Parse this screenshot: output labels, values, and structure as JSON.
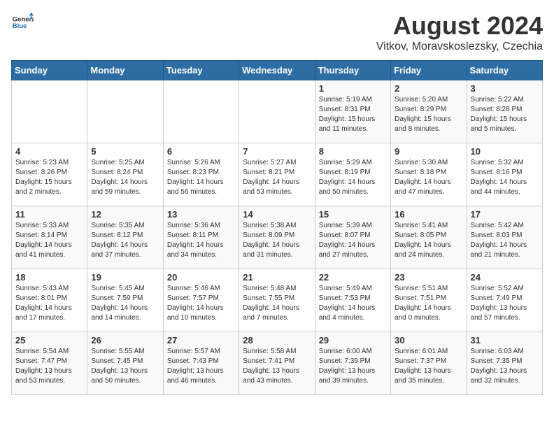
{
  "header": {
    "logo_general": "General",
    "logo_blue": "Blue",
    "title": "August 2024",
    "location": "Vitkov, Moravskoslezsky, Czechia"
  },
  "weekdays": [
    "Sunday",
    "Monday",
    "Tuesday",
    "Wednesday",
    "Thursday",
    "Friday",
    "Saturday"
  ],
  "weeks": [
    [
      {
        "day": "",
        "info": ""
      },
      {
        "day": "",
        "info": ""
      },
      {
        "day": "",
        "info": ""
      },
      {
        "day": "",
        "info": ""
      },
      {
        "day": "1",
        "info": "Sunrise: 5:19 AM\nSunset: 8:31 PM\nDaylight: 15 hours\nand 11 minutes."
      },
      {
        "day": "2",
        "info": "Sunrise: 5:20 AM\nSunset: 8:29 PM\nDaylight: 15 hours\nand 8 minutes."
      },
      {
        "day": "3",
        "info": "Sunrise: 5:22 AM\nSunset: 8:28 PM\nDaylight: 15 hours\nand 5 minutes."
      }
    ],
    [
      {
        "day": "4",
        "info": "Sunrise: 5:23 AM\nSunset: 8:26 PM\nDaylight: 15 hours\nand 2 minutes."
      },
      {
        "day": "5",
        "info": "Sunrise: 5:25 AM\nSunset: 8:24 PM\nDaylight: 14 hours\nand 59 minutes."
      },
      {
        "day": "6",
        "info": "Sunrise: 5:26 AM\nSunset: 8:23 PM\nDaylight: 14 hours\nand 56 minutes."
      },
      {
        "day": "7",
        "info": "Sunrise: 5:27 AM\nSunset: 8:21 PM\nDaylight: 14 hours\nand 53 minutes."
      },
      {
        "day": "8",
        "info": "Sunrise: 5:29 AM\nSunset: 8:19 PM\nDaylight: 14 hours\nand 50 minutes."
      },
      {
        "day": "9",
        "info": "Sunrise: 5:30 AM\nSunset: 8:18 PM\nDaylight: 14 hours\nand 47 minutes."
      },
      {
        "day": "10",
        "info": "Sunrise: 5:32 AM\nSunset: 8:16 PM\nDaylight: 14 hours\nand 44 minutes."
      }
    ],
    [
      {
        "day": "11",
        "info": "Sunrise: 5:33 AM\nSunset: 8:14 PM\nDaylight: 14 hours\nand 41 minutes."
      },
      {
        "day": "12",
        "info": "Sunrise: 5:35 AM\nSunset: 8:12 PM\nDaylight: 14 hours\nand 37 minutes."
      },
      {
        "day": "13",
        "info": "Sunrise: 5:36 AM\nSunset: 8:11 PM\nDaylight: 14 hours\nand 34 minutes."
      },
      {
        "day": "14",
        "info": "Sunrise: 5:38 AM\nSunset: 8:09 PM\nDaylight: 14 hours\nand 31 minutes."
      },
      {
        "day": "15",
        "info": "Sunrise: 5:39 AM\nSunset: 8:07 PM\nDaylight: 14 hours\nand 27 minutes."
      },
      {
        "day": "16",
        "info": "Sunrise: 5:41 AM\nSunset: 8:05 PM\nDaylight: 14 hours\nand 24 minutes."
      },
      {
        "day": "17",
        "info": "Sunrise: 5:42 AM\nSunset: 8:03 PM\nDaylight: 14 hours\nand 21 minutes."
      }
    ],
    [
      {
        "day": "18",
        "info": "Sunrise: 5:43 AM\nSunset: 8:01 PM\nDaylight: 14 hours\nand 17 minutes."
      },
      {
        "day": "19",
        "info": "Sunrise: 5:45 AM\nSunset: 7:59 PM\nDaylight: 14 hours\nand 14 minutes."
      },
      {
        "day": "20",
        "info": "Sunrise: 5:46 AM\nSunset: 7:57 PM\nDaylight: 14 hours\nand 10 minutes."
      },
      {
        "day": "21",
        "info": "Sunrise: 5:48 AM\nSunset: 7:55 PM\nDaylight: 14 hours\nand 7 minutes."
      },
      {
        "day": "22",
        "info": "Sunrise: 5:49 AM\nSunset: 7:53 PM\nDaylight: 14 hours\nand 4 minutes."
      },
      {
        "day": "23",
        "info": "Sunrise: 5:51 AM\nSunset: 7:51 PM\nDaylight: 14 hours\nand 0 minutes."
      },
      {
        "day": "24",
        "info": "Sunrise: 5:52 AM\nSunset: 7:49 PM\nDaylight: 13 hours\nand 57 minutes."
      }
    ],
    [
      {
        "day": "25",
        "info": "Sunrise: 5:54 AM\nSunset: 7:47 PM\nDaylight: 13 hours\nand 53 minutes."
      },
      {
        "day": "26",
        "info": "Sunrise: 5:55 AM\nSunset: 7:45 PM\nDaylight: 13 hours\nand 50 minutes."
      },
      {
        "day": "27",
        "info": "Sunrise: 5:57 AM\nSunset: 7:43 PM\nDaylight: 13 hours\nand 46 minutes."
      },
      {
        "day": "28",
        "info": "Sunrise: 5:58 AM\nSunset: 7:41 PM\nDaylight: 13 hours\nand 43 minutes."
      },
      {
        "day": "29",
        "info": "Sunrise: 6:00 AM\nSunset: 7:39 PM\nDaylight: 13 hours\nand 39 minutes."
      },
      {
        "day": "30",
        "info": "Sunrise: 6:01 AM\nSunset: 7:37 PM\nDaylight: 13 hours\nand 35 minutes."
      },
      {
        "day": "31",
        "info": "Sunrise: 6:03 AM\nSunset: 7:35 PM\nDaylight: 13 hours\nand 32 minutes."
      }
    ]
  ]
}
